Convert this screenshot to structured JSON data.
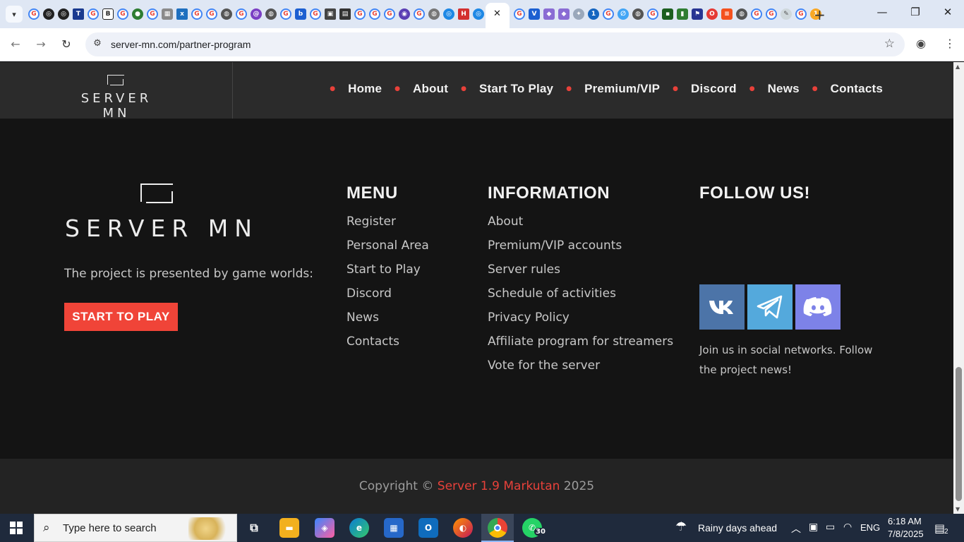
{
  "browser": {
    "url": "server-mn.com/partner-program",
    "active_tab_close": "✕",
    "new_tab": "+",
    "window_controls": [
      "—",
      "❐",
      "✕"
    ]
  },
  "header": {
    "logo_text": "SERVER MN",
    "nav": [
      "Home",
      "About",
      "Start To Play",
      "Premium/VIP",
      "Discord",
      "News",
      "Contacts"
    ]
  },
  "footer": {
    "logo_text": "SERVER MN",
    "project_text": "The project is presented by game worlds:",
    "cta_label": "START TO PLAY",
    "menu": {
      "title": "MENU",
      "items": [
        "Register",
        "Personal Area",
        "Start to Play",
        "Discord",
        "News",
        "Contacts"
      ]
    },
    "information": {
      "title": "INFORMATION",
      "items": [
        "About",
        "Premium/VIP accounts",
        "Server rules",
        "Schedule of activities",
        "Privacy Policy",
        "Affiliate program for streamers",
        "Vote for the server"
      ]
    },
    "follow": {
      "title": "FOLLOW US!",
      "text": "Join us in social networks. Follow the project news!",
      "icons": [
        "vk-icon",
        "telegram-icon",
        "discord-icon"
      ]
    },
    "copyright": {
      "prefix": "Copyright © ",
      "link": "Server 1.9 Markutan",
      "suffix": " 2025"
    }
  },
  "taskbar": {
    "search_placeholder": "Type here to search",
    "whatsapp_badge": "30",
    "weather": "Rainy days ahead",
    "language": "ENG",
    "time": "6:18 AM",
    "date": "7/8/2025",
    "notifications": "2"
  },
  "colors": {
    "accent": "#f04438",
    "header_bg": "#2b2b2b",
    "footer_bg": "#141414",
    "copyright_bg": "#232323",
    "vk": "#4c74a8",
    "telegram": "#54a9dc",
    "discord": "#7d82e8"
  }
}
